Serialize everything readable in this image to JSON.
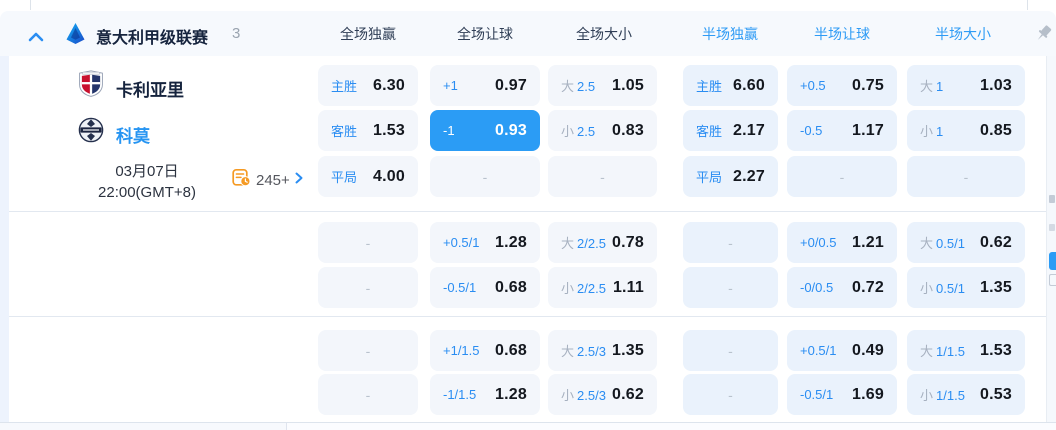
{
  "header": {
    "league_name": "意大利甲级联赛",
    "match_count": "3",
    "columns": [
      {
        "label": "全场独赢",
        "highlight": false
      },
      {
        "label": "全场让球",
        "highlight": false
      },
      {
        "label": "全场大小",
        "highlight": false
      },
      {
        "label": "半场独赢",
        "highlight": true
      },
      {
        "label": "半场让球",
        "highlight": true
      },
      {
        "label": "半场大小",
        "highlight": true
      }
    ]
  },
  "match": {
    "home_team": "卡利亚里",
    "away_team": "科莫",
    "date": "03月07日",
    "time": "22:00(GMT+8)",
    "markets_count": "245+"
  },
  "odds_blocks": [
    {
      "rows": [
        [
          {
            "label": "主胜",
            "value": "6.30"
          },
          {
            "label": "+1",
            "value": "0.97"
          },
          {
            "prefix": "大",
            "line": "2.5",
            "value": "1.05"
          },
          {
            "label": "主胜",
            "value": "6.60"
          },
          {
            "label": "+0.5",
            "value": "0.75"
          },
          {
            "prefix": "大",
            "line": "1",
            "value": "1.03"
          }
        ],
        [
          {
            "label": "客胜",
            "value": "1.53"
          },
          {
            "label": "-1",
            "value": "0.93",
            "selected": true
          },
          {
            "prefix": "小",
            "line": "2.5",
            "value": "0.83"
          },
          {
            "label": "客胜",
            "value": "2.17"
          },
          {
            "label": "-0.5",
            "value": "1.17"
          },
          {
            "prefix": "小",
            "line": "1",
            "value": "0.85"
          }
        ],
        [
          {
            "label": "平局",
            "value": "4.00"
          },
          {
            "empty": true,
            "text": "-"
          },
          {
            "empty": true,
            "text": "-"
          },
          {
            "label": "平局",
            "value": "2.27"
          },
          {
            "empty": true,
            "text": "-"
          },
          {
            "empty": true,
            "text": "-"
          }
        ]
      ]
    },
    {
      "rows": [
        [
          {
            "empty": true,
            "text": "-"
          },
          {
            "label": "+0.5/1",
            "value": "1.28"
          },
          {
            "prefix": "大",
            "line": "2/2.5",
            "value": "0.78"
          },
          {
            "empty": true,
            "text": "-"
          },
          {
            "label": "+0/0.5",
            "value": "1.21"
          },
          {
            "prefix": "大",
            "line": "0.5/1",
            "value": "0.62"
          }
        ],
        [
          {
            "empty": true,
            "text": "-"
          },
          {
            "label": "-0.5/1",
            "value": "0.68"
          },
          {
            "prefix": "小",
            "line": "2/2.5",
            "value": "1.11"
          },
          {
            "empty": true,
            "text": "-"
          },
          {
            "label": "-0/0.5",
            "value": "0.72"
          },
          {
            "prefix": "小",
            "line": "0.5/1",
            "value": "1.35"
          }
        ]
      ]
    },
    {
      "rows": [
        [
          {
            "empty": true,
            "text": "-"
          },
          {
            "label": "+1/1.5",
            "value": "0.68"
          },
          {
            "prefix": "大",
            "line": "2.5/3",
            "value": "1.35"
          },
          {
            "empty": true,
            "text": "-"
          },
          {
            "label": "+0.5/1",
            "value": "0.49"
          },
          {
            "prefix": "大",
            "line": "1/1.5",
            "value": "1.53"
          }
        ],
        [
          {
            "empty": true,
            "text": "-"
          },
          {
            "label": "-1/1.5",
            "value": "1.28"
          },
          {
            "prefix": "小",
            "line": "2.5/3",
            "value": "0.62"
          },
          {
            "empty": true,
            "text": "-"
          },
          {
            "label": "-0.5/1",
            "value": "1.69"
          },
          {
            "prefix": "小",
            "line": "1/1.5",
            "value": "0.53"
          }
        ]
      ]
    }
  ],
  "icons": {
    "collapse": "chevron-up",
    "league": "serie-a-logo",
    "markets": "stats-clock",
    "more": "chevron-right",
    "pin": "pushpin"
  },
  "colors": {
    "accent_blue": "#2a8df2",
    "selected_cell": "#2b9cf5",
    "highlight_header": "#2e9bf5",
    "orange_icon": "#f59a23",
    "dark_text": "#16243e",
    "cell_bg_full": "#f3f6fb",
    "cell_bg_half": "#eaf2fc"
  }
}
